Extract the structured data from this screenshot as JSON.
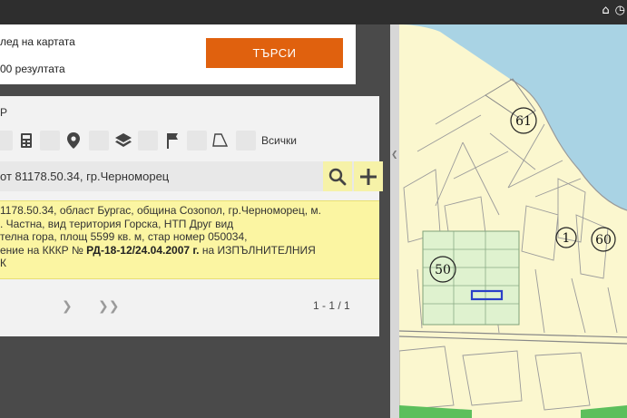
{
  "topbar": {
    "icons": [
      "home-icon",
      "history-icon"
    ]
  },
  "search": {
    "option_1": "лед на картата",
    "option_2": "00 резултата",
    "button_label": "ТЪРСИ",
    "accent_color": "#e0610e"
  },
  "results": {
    "header": "Р",
    "filter_icons": [
      "building-icon",
      "pin-icon",
      "layers-icon",
      "flag-icon",
      "area-icon"
    ],
    "all_label": "Всички",
    "query_text": "от 81178.50.34, гр.Черноморец",
    "card": {
      "line1": "1178.50.34, област Бургас, община Созопол, гр.Черноморец, м.",
      "line2": ". Частна, вид територия Горска, НТП Друг вид",
      "line3": "телна гора, площ 5599 кв. м, стар номер 050034,",
      "line4_prefix": "ение на КККР №",
      "line4_bold": "РД-18-12/24.04.2007 г.",
      "line4_suffix": "на ИЗПЪЛНИТЕЛНИЯ",
      "line5": "К"
    },
    "pagination": "1 - 1 / 1"
  },
  "map": {
    "labels": [
      "61",
      "1",
      "60",
      "50"
    ],
    "sea_color": "#a9d3e4",
    "land_color": "#fbf7cf",
    "forest_color": "#dff2cf",
    "highlight_color": "#2a3fc8"
  }
}
